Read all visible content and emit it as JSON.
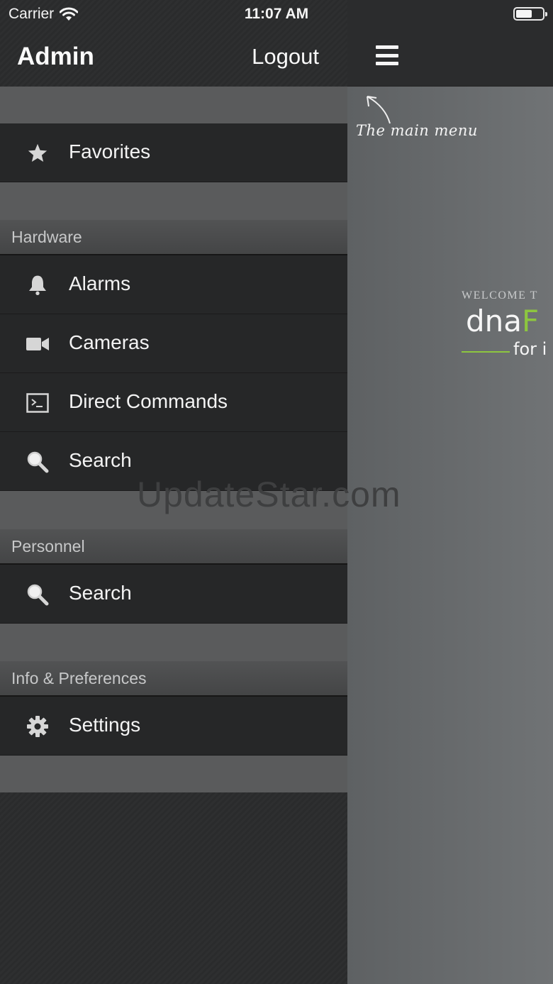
{
  "status_bar": {
    "carrier": "Carrier",
    "time": "11:07 AM"
  },
  "header": {
    "title": "Admin",
    "logout_label": "Logout"
  },
  "menu": {
    "favorites": "Favorites",
    "hardware_header": "Hardware",
    "hardware_items": [
      "Alarms",
      "Cameras",
      "Direct Commands",
      "Search"
    ],
    "personnel_header": "Personnel",
    "personnel_items": [
      "Search"
    ],
    "info_header": "Info & Preferences",
    "info_items": [
      "Settings"
    ]
  },
  "content": {
    "annotation": "The main menu",
    "welcome": "WELCOME T",
    "brand_main": "dna",
    "brand_accent": "F",
    "brand_sub": "for i"
  },
  "watermark": "UpdateStar.com",
  "colors": {
    "accent_green": "#8dc63f",
    "drawer_bg": "#2a2b2c",
    "section_bg": "#4a4b4c"
  },
  "icons": {
    "favorites": "star-icon",
    "alarms": "bell-icon",
    "cameras": "video-camera-icon",
    "direct_commands": "terminal-icon",
    "search": "magnifier-icon",
    "settings": "gear-icon",
    "menu": "hamburger-icon",
    "wifi": "wifi-icon",
    "battery": "battery-icon"
  }
}
